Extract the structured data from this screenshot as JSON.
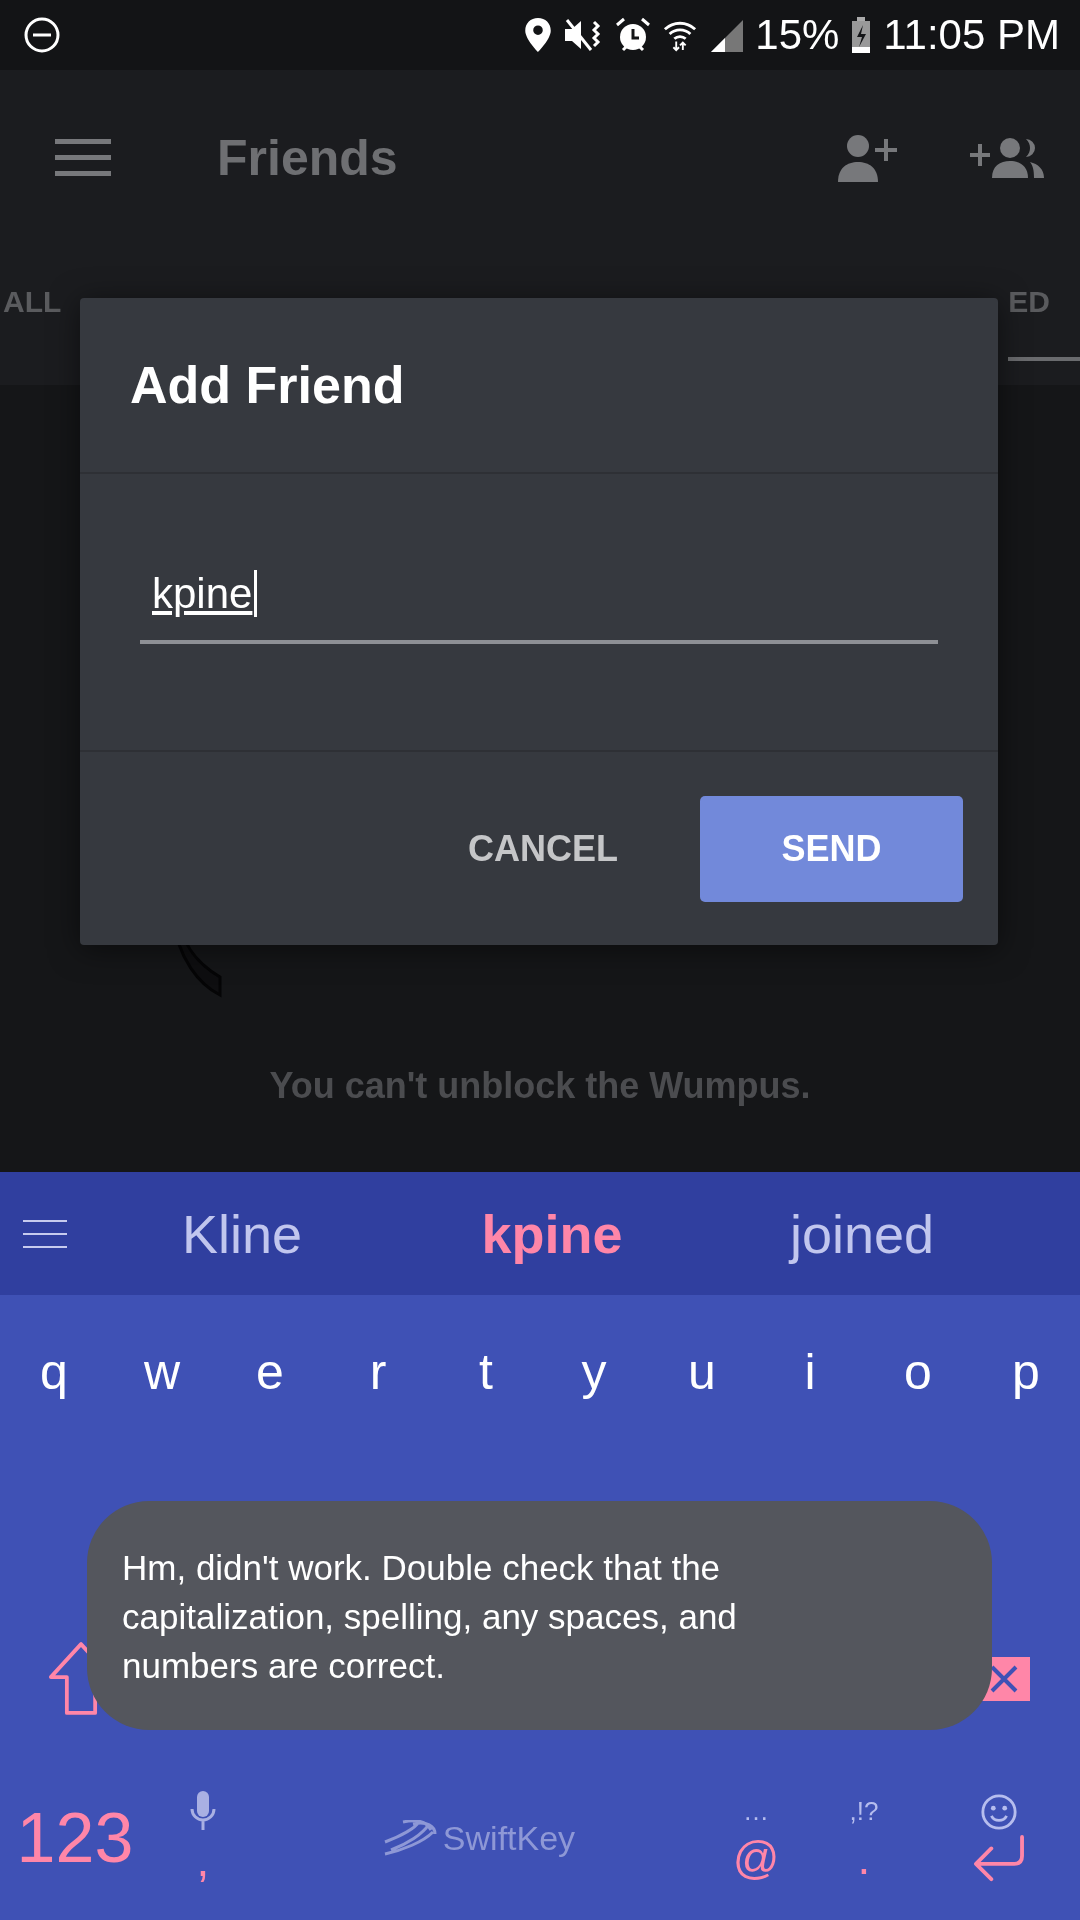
{
  "status_bar": {
    "battery": "15%",
    "time": "11:05 PM"
  },
  "app_bar": {
    "title": "Friends"
  },
  "tabs": [
    {
      "label": "ALL",
      "selected": false
    },
    {
      "label": "ED",
      "selected": true
    }
  ],
  "empty_state": {
    "message": "You can't unblock the Wumpus."
  },
  "dialog": {
    "title": "Add Friend",
    "input": {
      "value": "kpine"
    },
    "buttons": [
      {
        "label": "CANCEL",
        "kind": "text"
      },
      {
        "label": "SEND",
        "kind": "primary"
      }
    ]
  },
  "keyboard": {
    "suggestions": [
      {
        "text": "Kline",
        "selected": false
      },
      {
        "text": "kpine",
        "selected": true
      },
      {
        "text": "joined",
        "selected": false
      }
    ],
    "rows": [
      [
        "q",
        "w",
        "e",
        "r",
        "t",
        "y",
        "u",
        "i",
        "o",
        "p"
      ]
    ],
    "bottom_keys": [
      {
        "kind": "symbols",
        "label": "123"
      },
      {
        "kind": "mic",
        "label": ","
      },
      {
        "kind": "space",
        "label": "SwiftKey"
      },
      {
        "kind": "hint",
        "hint": "…",
        "label": "@"
      },
      {
        "kind": "hint",
        "hint": ",!?",
        "label": "."
      },
      {
        "kind": "enter"
      }
    ]
  },
  "toast": {
    "text": "Hm, didn't work. Double check that the capitalization, spelling, any spaces, and numbers are correct."
  }
}
